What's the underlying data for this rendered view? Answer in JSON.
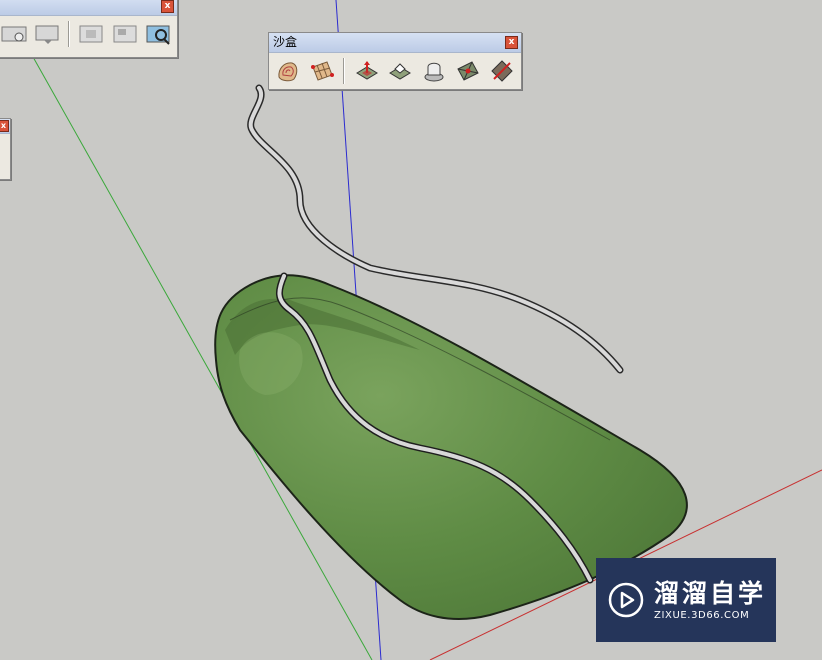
{
  "sandbox_toolbar": {
    "title": "沙盒",
    "close_label": "x",
    "tools": [
      {
        "name": "from-contours",
        "icon": "contour-terrain-icon"
      },
      {
        "name": "from-scratch",
        "icon": "grid-terrain-icon"
      },
      {
        "name": "smoove",
        "icon": "smoove-icon"
      },
      {
        "name": "stamp",
        "icon": "stamp-icon"
      },
      {
        "name": "drape",
        "icon": "drape-icon"
      },
      {
        "name": "add-detail",
        "icon": "add-detail-icon"
      },
      {
        "name": "flip-edge",
        "icon": "flip-edge-icon"
      }
    ]
  },
  "camera_toolbar": {
    "close_label": "x"
  },
  "side_toolbar": {
    "close_label": "x"
  },
  "watermark": {
    "brand": "溜溜自学",
    "url": "ZIXUE.3D66.COM"
  },
  "colors": {
    "background": "#c9c9c6",
    "terrain": "#5f8c45",
    "blue_axis": "#2b2bd0",
    "green_axis": "#3aa83a",
    "red_axis": "#c83030",
    "watermark_bg": "#25355a"
  }
}
